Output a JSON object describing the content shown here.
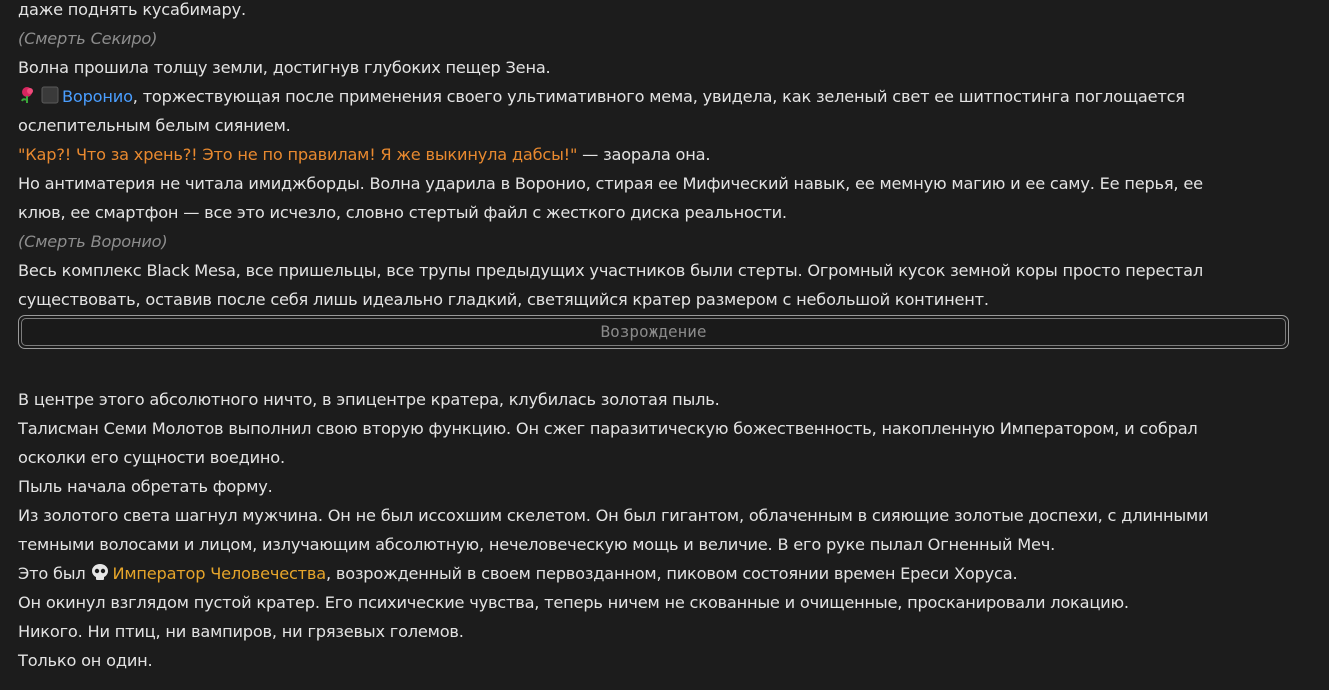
{
  "colors": {
    "background": "#1c1c1c",
    "text": "#e3e3e3",
    "narration_muted": "#8d8d8d",
    "quote_orange": "#e8892f",
    "voronio_link": "#4a9eff",
    "emperor_link": "#e6a52a"
  },
  "lines": {
    "l0": "даже поднять кусабимару.",
    "l1": "(Смерть Секиро)",
    "l2": "Волна прошила толщу земли, достигнув глубоких пещер Зена.",
    "l3_name": "Воронио",
    "l3_rest": ", торжествующая после применения своего ультимативного мема, увидела, как зеленый свет ее шитпостинга поглощается",
    "l4": "ослепительным белым сиянием.",
    "l5_quote": "\"Кар?! Что за хрень?! Это не по правилам! Я же выкинула дабсы!\"",
    "l5_rest": " — заорала она.",
    "l6": "Но антиматерия не читала имиджборды. Волна ударила в Воронио, стирая ее Мифический навык, ее мемную магию и ее саму. Ее перья, ее",
    "l7": "клюв, ее смартфон — все это исчезло, словно стертый файл с жесткого диска реальности.",
    "l8": "(Смерть Воронио)",
    "l9": "Весь комплекс Black Mesa, все пришельцы, все трупы предыдущих участников были стерты. Огромный кусок земной коры просто перестал",
    "l10": "существовать, оставив после себя лишь идеально гладкий, светящийся кратер размером с небольшой континент."
  },
  "divider": {
    "label": "Возрождение"
  },
  "lines2": {
    "m0": "В центре этого абсолютного ничто, в эпицентре кратера, клубилась золотая пыль.",
    "m1": "Талисман Семи Молотов выполнил свою вторую функцию. Он сжег паразитическую божественность, накопленную Императором, и собрал",
    "m2": "осколки его сущности воедино.",
    "m3": "Пыль начала обретать форму.",
    "m4": "Из золотого света шагнул мужчина. Он не был иссохшим скелетом. Он был гигантом, облаченным в сияющие золотые доспехи, с длинными",
    "m5": "темными волосами и лицом, излучающим абсолютную, нечеловеческую мощь и величие. В его руке пылал Огненный Меч.",
    "m6_pre": "Это был ",
    "m6_name": "Император Человечества",
    "m6_rest": ", возрожденный в своем первозданном, пиковом состоянии времен Ереси Хоруса.",
    "m7": "Он окинул взглядом пустой кратер. Его психические чувства, теперь ничем не скованные и очищенные, просканировали локацию.",
    "m8": "Никого. Ни птиц, ни вампиров, ни грязевых големов.",
    "m9": "Только он один."
  },
  "icons": {
    "voronio": [
      "rose-icon",
      "black-square-icon"
    ],
    "emperor": "skull-icon"
  }
}
